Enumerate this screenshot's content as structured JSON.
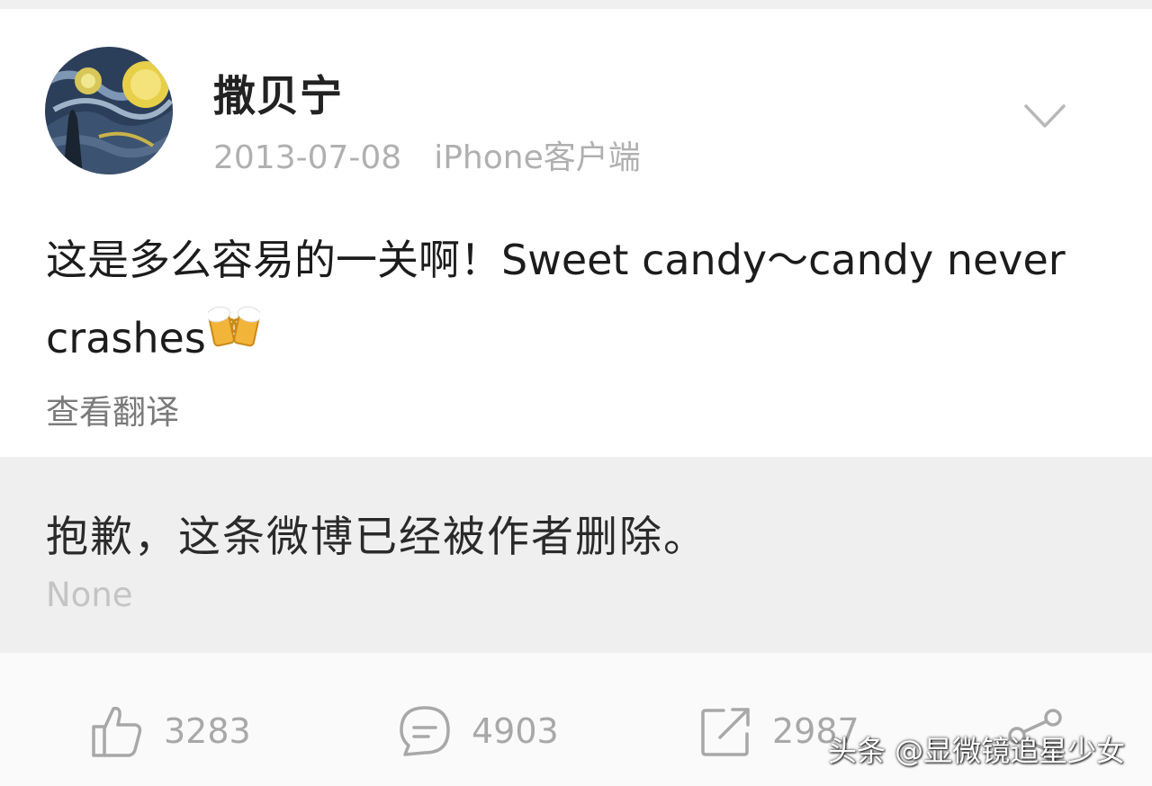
{
  "post": {
    "username": "撒贝宁",
    "date": "2013-07-08",
    "source": "iPhone客户端",
    "text": "这是多么容易的一关啊！Sweet candy～candy never crashes",
    "emoji": "cheers-beer-emoji",
    "translate_label": "查看翻译"
  },
  "retweet": {
    "deleted_text": "抱歉，这条微博已经被作者删除。",
    "sub_text": "None"
  },
  "actions": {
    "like_count": "3283",
    "comment_count": "4903",
    "repost_count": "2987"
  },
  "watermark": "头条 @显微镜追星少女",
  "icons": {
    "menu": "chevron-down-icon",
    "like": "thumbs-up-icon",
    "comment": "comment-bubble-icon",
    "repost": "repost-arrow-icon",
    "share": "share-icon"
  },
  "colors": {
    "text_primary": "#1c1c1c",
    "text_muted": "#b0b0b0",
    "retweet_bg": "#efefef"
  }
}
